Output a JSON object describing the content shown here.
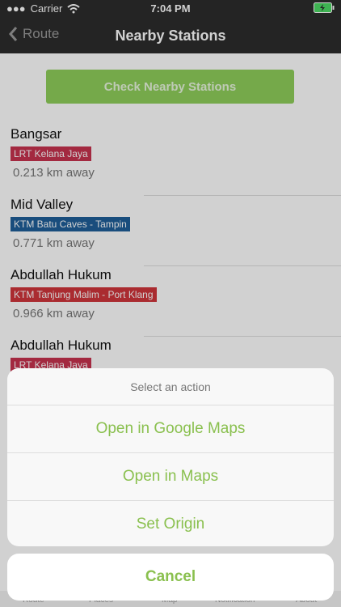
{
  "status": {
    "carrier": "Carrier",
    "time": "7:04 PM"
  },
  "nav": {
    "back_label": "Route",
    "title": "Nearby Stations"
  },
  "check_button": "Check Nearby Stations",
  "stations": [
    {
      "name": "Bangsar",
      "line": "LRT Kelana Jaya",
      "line_color": "#c7334f",
      "distance": "0.213 km away"
    },
    {
      "name": "Mid Valley",
      "line": "KTM Batu Caves - Tampin",
      "line_color": "#1f5f99",
      "distance": "0.771 km away"
    },
    {
      "name": "Abdullah Hukum",
      "line": "KTM Tanjung Malim - Port Klang",
      "line_color": "#d0353b",
      "distance": "0.966 km away"
    },
    {
      "name": "Abdullah Hukum",
      "line": "LRT Kelana Jaya",
      "line_color": "#c7334f",
      "distance": ""
    }
  ],
  "tabs": [
    "Route",
    "Places",
    "Map",
    "Notification",
    "About"
  ],
  "action_sheet": {
    "title": "Select an action",
    "actions": [
      "Open in Google Maps",
      "Open in Maps",
      "Set Origin"
    ],
    "cancel": "Cancel"
  },
  "colors": {
    "accent": "#8ac04f",
    "bar": "#2c2c2c"
  }
}
